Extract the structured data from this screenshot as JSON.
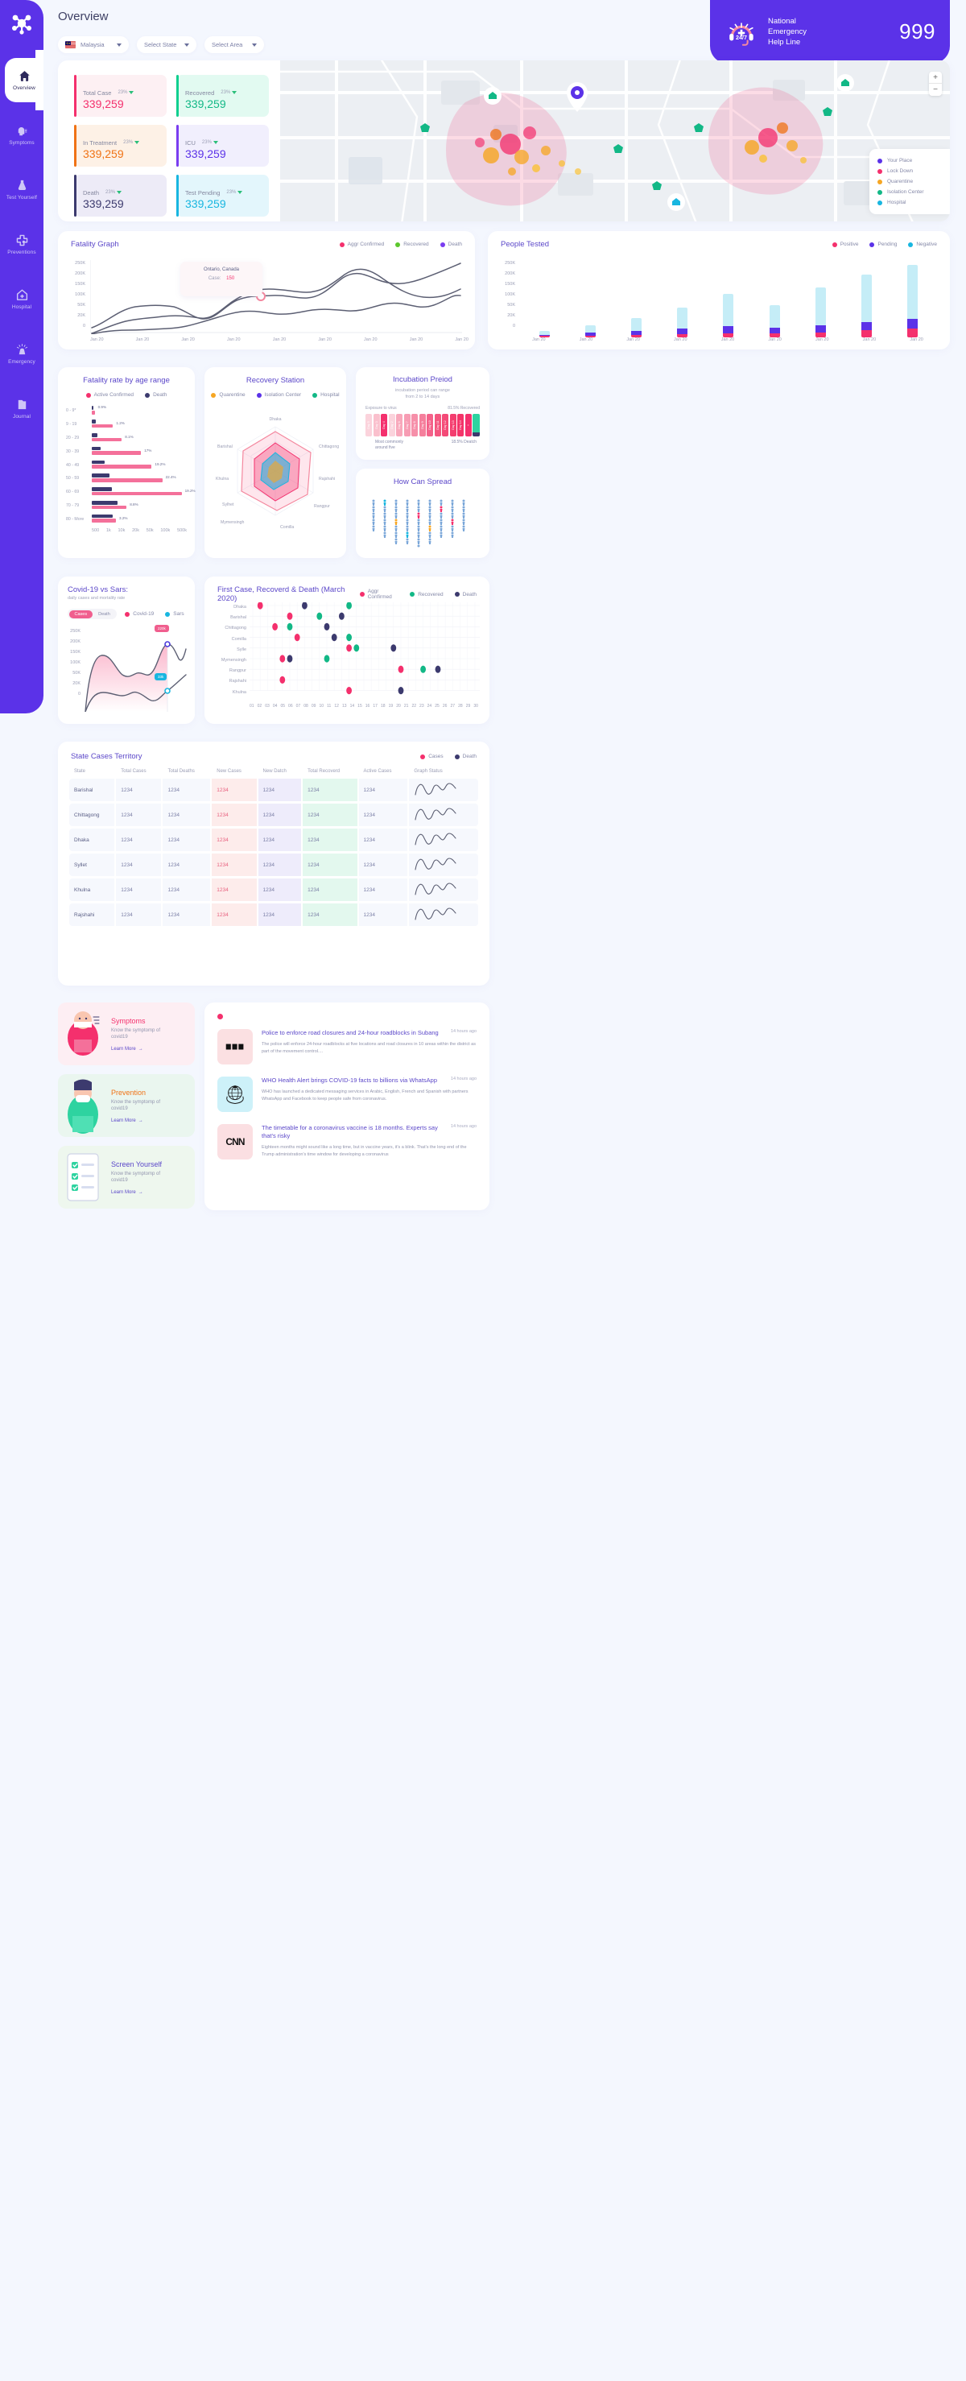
{
  "sidebar": {
    "logo_icon": "virus-logo-icon",
    "items": [
      {
        "label": "Overview",
        "icon": "home-icon",
        "active": true
      },
      {
        "label": "Symptoms",
        "icon": "head-cough-icon",
        "active": false
      },
      {
        "label": "Test Yourself",
        "icon": "flask-icon",
        "active": false
      },
      {
        "label": "Preventions",
        "icon": "medical-cross-icon",
        "active": false
      },
      {
        "label": "Hospital",
        "icon": "hospital-icon",
        "active": false
      },
      {
        "label": "Emergency",
        "icon": "siren-icon",
        "active": false
      },
      {
        "label": "Journal",
        "icon": "book-icon",
        "active": false
      }
    ]
  },
  "header": {
    "title": "Overview",
    "helpline": {
      "icon": "headset-24-7-icon",
      "line1": "National",
      "line2": "Emergency",
      "line3": "Help Line",
      "number": "999"
    }
  },
  "filters": [
    {
      "label": "Malaysia",
      "icon": "flag-malaysia-icon",
      "has_flag": true
    },
    {
      "label": "Select State",
      "has_flag": false
    },
    {
      "label": "Select Area",
      "has_flag": false
    }
  ],
  "stats": [
    {
      "label": "Total Case",
      "value": "339,259",
      "pct": "23%",
      "color": "#f4306d",
      "bg": "#fdf0f3",
      "bar": "#f4306d"
    },
    {
      "label": "Recovered",
      "value": "339,259",
      "pct": "23%",
      "color": "#12b886",
      "bg": "#e2faf1",
      "bar": "#0ecf8f"
    },
    {
      "label": "In Treatment",
      "value": "339,259",
      "pct": "23%",
      "color": "#f07316",
      "bg": "#fdf1e6",
      "bar": "#f07316"
    },
    {
      "label": "ICU",
      "value": "339,259",
      "pct": "23%",
      "color": "#5b32e8",
      "bg": "#f1effd",
      "bar": "#7a3df0"
    },
    {
      "label": "Death",
      "value": "339,259",
      "pct": "23%",
      "color": "#3c3a6e",
      "bg": "#edebf7",
      "bar": "#3c3a6e"
    },
    {
      "label": "Test Pending",
      "value": "339,259",
      "pct": "23%",
      "color": "#18b6e0",
      "bg": "#e3f6fc",
      "bar": "#18b6e0"
    }
  ],
  "map": {
    "zoom_in": "+",
    "zoom_out": "−",
    "legend": [
      {
        "label": "Your Place",
        "color": "#5b32e8"
      },
      {
        "label": "Lock Down",
        "color": "#f4306d"
      },
      {
        "label": "Quarentine",
        "color": "#f6a623"
      },
      {
        "label": "Isolation Center",
        "color": "#12b886"
      },
      {
        "label": "Hospital",
        "color": "#18b6e0"
      }
    ]
  },
  "chart_data": [
    {
      "type": "line",
      "title": "Fatality Graph",
      "legend": [
        {
          "name": "Aggr Confirmed",
          "color": "#f4306d"
        },
        {
          "name": "Recovered",
          "color": "#5cc72c"
        },
        {
          "name": "Death",
          "color": "#7a3df0"
        }
      ],
      "ylabel": "",
      "xlabel": "",
      "yticks": [
        "250K",
        "200K",
        "150K",
        "100K",
        "50K",
        "20K",
        "0"
      ],
      "ylim": [
        0,
        250000
      ],
      "xticks": [
        "Jan 20",
        "Jan 20",
        "Jan 20",
        "Jan 20",
        "Jan 20",
        "Jan 20",
        "Jan 20",
        "Jan 20",
        "Jan 20"
      ],
      "grid": false,
      "tooltip": {
        "location": "Ontario, Canada",
        "label": "Case:",
        "value": "150"
      },
      "series": [
        {
          "name": "Aggr Confirmed",
          "values": [
            18,
            28,
            32,
            31,
            22,
            46,
            42,
            33,
            38,
            72,
            150,
            148,
            130,
            120,
            108,
            130,
            175
          ]
        },
        {
          "name": "Recovered",
          "values": [
            -8,
            5,
            18,
            25,
            22,
            20,
            48,
            75,
            80,
            78,
            70,
            100,
            150,
            190,
            168,
            172,
            232
          ]
        },
        {
          "name": "Death",
          "values": [
            -14,
            1,
            3,
            5,
            4,
            5,
            7,
            9,
            13,
            20,
            16,
            22,
            25,
            23,
            38,
            55,
            98
          ]
        }
      ]
    },
    {
      "type": "bar",
      "title": "People Tested",
      "stacked": true,
      "legend": [
        {
          "name": "Positive",
          "color": "#f4306d"
        },
        {
          "name": "Pending",
          "color": "#5b32e8"
        },
        {
          "name": "Negative",
          "color": "#18b6e0"
        }
      ],
      "categories": [
        "Jan 20",
        "Jan 20",
        "Jan 20",
        "Jan 20",
        "Jan 20",
        "Jan 20",
        "Jan 20",
        "Jan 20",
        "Jan 20"
      ],
      "yticks": [
        "250K",
        "200K",
        "150K",
        "100K",
        "50K",
        "20K",
        "0"
      ],
      "ylim": [
        0,
        250000
      ],
      "series": [
        {
          "name": "Positive",
          "values": [
            5,
            8,
            9,
            14,
            17,
            16,
            20,
            30,
            35
          ]
        },
        {
          "name": "Pending",
          "values": [
            10,
            18,
            27,
            36,
            45,
            40,
            50,
            62,
            75
          ]
        },
        {
          "name": "Negative",
          "values": [
            25,
            47,
            78,
            120,
            175,
            128,
            200,
            252,
            290
          ]
        }
      ]
    },
    {
      "type": "bar",
      "orientation": "horizontal",
      "title": "Fatality rate by age range",
      "legend": [
        {
          "name": "Active Confirmed",
          "color": "#f4306d"
        },
        {
          "name": "Death",
          "color": "#3c3a6e"
        }
      ],
      "categories": [
        "0 - 9*",
        "9 - 19",
        "20 - 29",
        "30 - 39",
        "40 - 49",
        "50 - 59",
        "60 - 69",
        "70 - 79",
        "80 - More"
      ],
      "xticks": [
        "500",
        "1k",
        "10k",
        "20k",
        "50k",
        "100k",
        "500k"
      ],
      "data_labels": [
        "0.9%",
        "1.2%",
        "8.1%",
        "17%",
        "19.2%",
        "22.4%",
        "19.2%",
        "8.8%",
        "3.2%"
      ],
      "series": [
        {
          "name": "Active Confirmed",
          "values": [
            3,
            22,
            31,
            51,
            62,
            73,
            93,
            36,
            25
          ]
        },
        {
          "name": "Death",
          "values": [
            2,
            4,
            6,
            9,
            13,
            18,
            21,
            27,
            22
          ]
        }
      ]
    },
    {
      "type": "radar",
      "title": "Recovery Station",
      "legend": [
        {
          "name": "Quarentine",
          "color": "#f6a623"
        },
        {
          "name": "Isolation Center",
          "color": "#5b32e8"
        },
        {
          "name": "Hospital",
          "color": "#12b886"
        }
      ],
      "categories": [
        "Dhaka",
        "Chittagong",
        "Rajshahi",
        "Rangpur",
        "Comilla",
        "Mymensingh",
        "Sylhet",
        "Khulna",
        "Barishal"
      ],
      "series": [
        {
          "name": "Quarentine",
          "values": [
            70,
            55,
            60,
            45,
            62,
            58,
            66,
            52,
            64
          ]
        },
        {
          "name": "Isolation Center",
          "values": [
            50,
            38,
            44,
            32,
            46,
            40,
            48,
            36,
            42
          ]
        },
        {
          "name": "Hospital",
          "values": [
            32,
            24,
            28,
            20,
            30,
            26,
            30,
            22,
            27
          ]
        }
      ]
    },
    {
      "type": "line",
      "title": "Covid-19 vs Sars:",
      "subtitle": "daily cases and mortality rate",
      "toggle": [
        "Cases",
        "Death"
      ],
      "toggle_active": "Cases",
      "legend": [
        {
          "name": "Covid-19",
          "color": "#f4306d"
        },
        {
          "name": "Sars",
          "color": "#18b6e0"
        }
      ],
      "yticks": [
        "250K",
        "200K",
        "150K",
        "100K",
        "50K",
        "20K",
        "0"
      ],
      "ylim": [
        0,
        250000
      ],
      "annotations": [
        {
          "label": "220k",
          "color": "#f4306d"
        },
        {
          "label": "33k",
          "color": "#18b6e0"
        }
      ],
      "series": [
        {
          "name": "Covid-19",
          "values": [
            0,
            48,
            42,
            28,
            25,
            32,
            26,
            120,
            190,
            170,
            152,
            155,
            210
          ]
        },
        {
          "name": "Sars",
          "values": [
            -40,
            -5,
            8,
            14,
            12,
            18,
            12,
            8,
            10,
            16,
            6,
            20,
            50
          ]
        }
      ]
    },
    {
      "type": "scatter",
      "title": "First Case, Recoverd & Death (March 2020)",
      "legend": [
        {
          "name": "Aggr Confirmed",
          "color": "#f4306d"
        },
        {
          "name": "Recovered",
          "color": "#12b886"
        },
        {
          "name": "Death",
          "color": "#3c3a6e"
        }
      ],
      "ycategories": [
        "Dhaka",
        "Barishal",
        "Chittagong",
        "Comilla",
        "Sylle",
        "Mymensingh",
        "Rangpur",
        "Rajshahi",
        "Khulna"
      ],
      "xticks": [
        "01",
        "02",
        "03",
        "04",
        "05",
        "06",
        "07",
        "08",
        "09",
        "10",
        "11",
        "12",
        "13",
        "14",
        "15",
        "16",
        "17",
        "18",
        "19",
        "20",
        "21",
        "22",
        "23",
        "24",
        "25",
        "26",
        "27",
        "28",
        "29",
        "30"
      ],
      "points": [
        {
          "row": "Dhaka",
          "x": 2,
          "series": "Aggr Confirmed"
        },
        {
          "row": "Dhaka",
          "x": 8,
          "series": "Death"
        },
        {
          "row": "Dhaka",
          "x": 14,
          "series": "Recovered"
        },
        {
          "row": "Barishal",
          "x": 6,
          "series": "Aggr Confirmed"
        },
        {
          "row": "Barishal",
          "x": 10,
          "series": "Recovered"
        },
        {
          "row": "Barishal",
          "x": 13,
          "series": "Death"
        },
        {
          "row": "Chittagong",
          "x": 4,
          "series": "Aggr Confirmed"
        },
        {
          "row": "Chittagong",
          "x": 6,
          "series": "Recovered"
        },
        {
          "row": "Chittagong",
          "x": 11,
          "series": "Death"
        },
        {
          "row": "Comilla",
          "x": 7,
          "series": "Aggr Confirmed"
        },
        {
          "row": "Comilla",
          "x": 12,
          "series": "Death"
        },
        {
          "row": "Comilla",
          "x": 14,
          "series": "Recovered"
        },
        {
          "row": "Sylle",
          "x": 14,
          "series": "Aggr Confirmed"
        },
        {
          "row": "Sylle",
          "x": 15,
          "series": "Recovered"
        },
        {
          "row": "Sylle",
          "x": 20,
          "series": "Death"
        },
        {
          "row": "Mymensingh",
          "x": 5,
          "series": "Aggr Confirmed"
        },
        {
          "row": "Mymensingh",
          "x": 6,
          "series": "Death"
        },
        {
          "row": "Mymensingh",
          "x": 11,
          "series": "Recovered"
        },
        {
          "row": "Rangpur",
          "x": 21,
          "series": "Aggr Confirmed"
        },
        {
          "row": "Rangpur",
          "x": 24,
          "series": "Recovered"
        },
        {
          "row": "Rangpur",
          "x": 26,
          "series": "Death"
        },
        {
          "row": "Rajshahi",
          "x": 5,
          "series": "Aggr Confirmed"
        },
        {
          "row": "Khulna",
          "x": 14,
          "series": "Aggr Confirmed"
        },
        {
          "row": "Khulna",
          "x": 21,
          "series": "Death"
        }
      ]
    }
  ],
  "incubation": {
    "title": "Incubation Preiod",
    "subtitle_line1": "incubation period can range",
    "subtitle_line2": "from 2 to 14 days",
    "left_label": "Exposure to virus",
    "right_label": "81.5% Recovered",
    "bottom_left_line1": "Most commonly",
    "bottom_left_line2": "around five",
    "bottom_right": "18.5% Deatch",
    "day_labels": [
      "Day 5",
      "Day 3",
      "Day 4",
      "Day 2",
      "Day 6",
      "Day 7",
      "Day 8",
      "Day 9",
      "Day 10",
      "Day 11",
      "Day 12",
      "Day 13",
      "Day 14",
      "+"
    ]
  },
  "spread": {
    "title": "How Can Spread"
  },
  "territory": {
    "title": "State Cases Territory",
    "legend": [
      {
        "name": "Cases",
        "color": "#f4306d"
      },
      {
        "name": "Death",
        "color": "#3c3a6e"
      }
    ],
    "columns": [
      "State",
      "Total Cases",
      "Total Deaths",
      "New Cases",
      "New Datch",
      "Total Recoverd",
      "Active Cases",
      "Graph Status"
    ],
    "rows": [
      {
        "state": "Barishal",
        "total_cases": "1234",
        "total_deaths": "1234",
        "new_cases": "1234",
        "new_datch": "1234",
        "total_recoverd": "1234",
        "active_cases": "1234"
      },
      {
        "state": "Chittagong",
        "total_cases": "1234",
        "total_deaths": "1234",
        "new_cases": "1234",
        "new_datch": "1234",
        "total_recoverd": "1234",
        "active_cases": "1234"
      },
      {
        "state": "Dhaka",
        "total_cases": "1234",
        "total_deaths": "1234",
        "new_cases": "1234",
        "new_datch": "1234",
        "total_recoverd": "1234",
        "active_cases": "1234"
      },
      {
        "state": "Syllet",
        "total_cases": "1234",
        "total_deaths": "1234",
        "new_cases": "1234",
        "new_datch": "1234",
        "total_recoverd": "1234",
        "active_cases": "1234"
      },
      {
        "state": "Khulna",
        "total_cases": "1234",
        "total_deaths": "1234",
        "new_cases": "1234",
        "new_datch": "1234",
        "total_recoverd": "1234",
        "active_cases": "1234"
      },
      {
        "state": "Rajshahi",
        "total_cases": "1234",
        "total_deaths": "1234",
        "new_cases": "1234",
        "new_datch": "1234",
        "total_recoverd": "1234",
        "active_cases": "1234"
      }
    ]
  },
  "info_cards": [
    {
      "title": "Symptoms",
      "desc_line1": "Know the symptomp of",
      "desc_line2": "covid19",
      "link": "Learn More",
      "color": "#f4306d",
      "bg": "#fdeef3",
      "icon": "person-sick-icon"
    },
    {
      "title": "Prevention",
      "desc_line1": "Know the symptomp of",
      "desc_line2": "covid19",
      "link": "Learn More",
      "color": "#f07316",
      "bg": "#eaf6ef",
      "icon": "person-mask-icon"
    },
    {
      "title": "Screen Yourself",
      "desc_line1": "Know the symptomp of",
      "desc_line2": "covid19",
      "link": "Learn More",
      "color": "#5b47c9",
      "bg": "#eef7ee",
      "icon": "checklist-icon"
    }
  ],
  "news": {
    "indicator_color": "#f4306d",
    "items": [
      {
        "thumb": "news-logo-icon",
        "thumb_bg": "#fbe0e2",
        "title": "Police to enforce road closures and 24-hour roadblocks in Subang",
        "time": "14 hours ago",
        "desc": "The police will enforce 24-hour roadblocks at five locations and road closures in 10 areas within the district as part of the movement control...."
      },
      {
        "thumb": "who-logo-icon",
        "thumb_bg": "#cdf1f9",
        "title": "WHO Health Alert brings COVID-19 facts to billions via WhatsApp",
        "time": "14 hours ago",
        "desc": "WHO has launched a dedicated messaging services in Arabic, English, French and Spanish with partners WhatsApp and Facebook to keep people safe from coronavirus."
      },
      {
        "thumb": "cnn-logo-icon",
        "thumb_bg": "#fbdfe2",
        "title": "The timetable for a coronavirus vaccine is 18 months. Experts say that's risky",
        "time": "14 hours ago",
        "desc": "Eighteen months might sound like a long time, but in vaccine years, it's a blink. That's the long end of the Trump administration's time window for developing a coronavirus"
      }
    ]
  }
}
